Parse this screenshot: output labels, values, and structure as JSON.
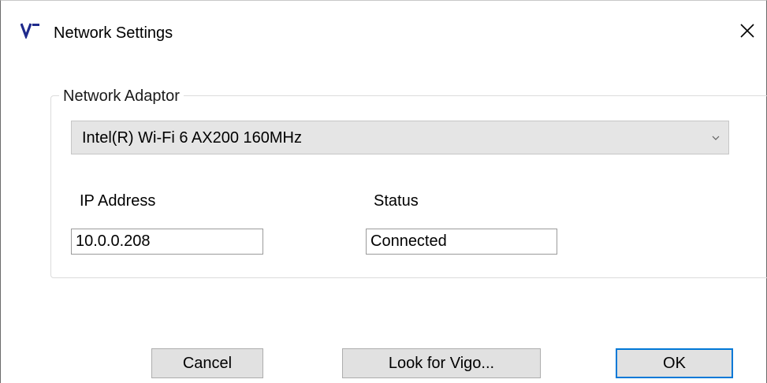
{
  "window": {
    "title": "Network Settings",
    "app_icon": "vigo-logo-icon",
    "close_icon": "close-icon"
  },
  "network_adaptor": {
    "group_label": "Network Adaptor",
    "selected_adapter": "Intel(R) Wi-Fi 6 AX200 160MHz",
    "dropdown_icon": "chevron-down-icon",
    "ip_address_label": "IP Address",
    "ip_address_value": "10.0.0.208",
    "status_label": "Status",
    "status_value": "Connected"
  },
  "buttons": {
    "cancel_label": "Cancel",
    "look_for_label": "Look for Vigo...",
    "ok_label": "OK"
  },
  "colors": {
    "logo_accent": "#1f2a8c",
    "default_button_border": "#0078d7",
    "button_face": "#e1e1e1"
  }
}
